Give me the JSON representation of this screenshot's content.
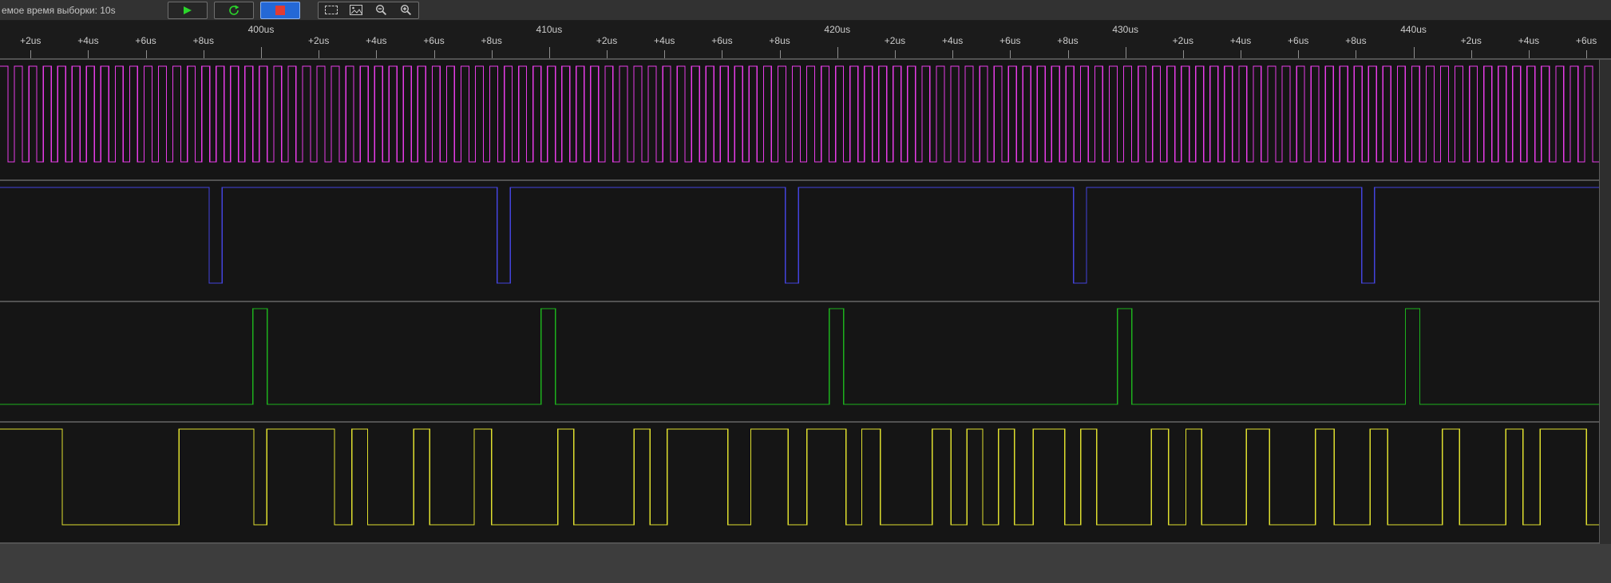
{
  "toolbar": {
    "status_text": "емое время выборки: 10s",
    "buttons": [
      {
        "id": "start-capture",
        "icon": "play-icon"
      },
      {
        "id": "loop-capture",
        "icon": "loop-icon"
      },
      {
        "id": "stop-capture",
        "icon": "stop-icon",
        "active": true
      },
      {
        "id": "select-region",
        "icon": "selection-box-icon"
      },
      {
        "id": "export-image",
        "icon": "image-icon"
      },
      {
        "id": "zoom-out",
        "icon": "zoom-out-icon"
      },
      {
        "id": "zoom-in",
        "icon": "zoom-in-icon"
      }
    ],
    "colors": {
      "active_button": "#2468d6",
      "icon_green": "#2bd62b",
      "icon_red": "#e33b32",
      "icon_gray": "#c8c8c8"
    }
  },
  "timeline": {
    "unit": "us",
    "start_us": 390.94,
    "end_us": 446.44,
    "ticks": [
      {
        "us": 392,
        "label": "+2us"
      },
      {
        "us": 394,
        "label": "+4us"
      },
      {
        "us": 396,
        "label": "+6us"
      },
      {
        "us": 398,
        "label": "+8us"
      },
      {
        "us": 400,
        "label": "400us"
      },
      {
        "us": 402,
        "label": "+2us"
      },
      {
        "us": 404,
        "label": "+4us"
      },
      {
        "us": 406,
        "label": "+6us"
      },
      {
        "us": 408,
        "label": "+8us"
      },
      {
        "us": 410,
        "label": "410us"
      },
      {
        "us": 412,
        "label": "+2us"
      },
      {
        "us": 414,
        "label": "+4us"
      },
      {
        "us": 416,
        "label": "+6us"
      },
      {
        "us": 418,
        "label": "+8us"
      },
      {
        "us": 420,
        "label": "420us"
      },
      {
        "us": 422,
        "label": "+2us"
      },
      {
        "us": 424,
        "label": "+4us"
      },
      {
        "us": 426,
        "label": "+6us"
      },
      {
        "us": 428,
        "label": "+8us"
      },
      {
        "us": 430,
        "label": "430us"
      },
      {
        "us": 432,
        "label": "+2us"
      },
      {
        "us": 434,
        "label": "+4us"
      },
      {
        "us": 436,
        "label": "+6us"
      },
      {
        "us": 438,
        "label": "+8us"
      },
      {
        "us": 440,
        "label": "440us"
      },
      {
        "us": 442,
        "label": "+2us"
      },
      {
        "us": 444,
        "label": "+4us"
      },
      {
        "us": 446,
        "label": "+6us"
      }
    ]
  },
  "channels": [
    {
      "name": "channel-0",
      "color": "#e83ce8",
      "type": "clock",
      "period_us": 0.5,
      "duty": 0.55
    },
    {
      "name": "channel-1",
      "color": "#4343dd",
      "type": "pulses",
      "base": "high",
      "first_pulse_us": 398.2,
      "period_us": 10,
      "width_us": 0.45
    },
    {
      "name": "channel-2",
      "color": "#1db11d",
      "type": "pulses",
      "base": "low",
      "first_pulse_us": 399.72,
      "period_us": 10,
      "width_us": 0.5
    },
    {
      "name": "channel-3",
      "color": "#dede2e",
      "type": "toggles",
      "initial": "high",
      "toggles_us": [
        393.1,
        397.15,
        399.75,
        400.2,
        402.55,
        403.15,
        403.7,
        405.3,
        405.85,
        407.4,
        408.0,
        410.3,
        410.85,
        412.95,
        413.5,
        414.1,
        416.2,
        417.0,
        418.3,
        418.95,
        420.3,
        420.85,
        421.5,
        423.3,
        423.95,
        424.5,
        425.05,
        425.6,
        426.15,
        426.8,
        427.9,
        428.45,
        429.0,
        430.9,
        431.5,
        432.1,
        432.65,
        434.2,
        435.0,
        436.6,
        437.25,
        438.5,
        439.1,
        441.0,
        441.6,
        443.2,
        443.8,
        444.4,
        446.0,
        446.6
      ]
    }
  ]
}
